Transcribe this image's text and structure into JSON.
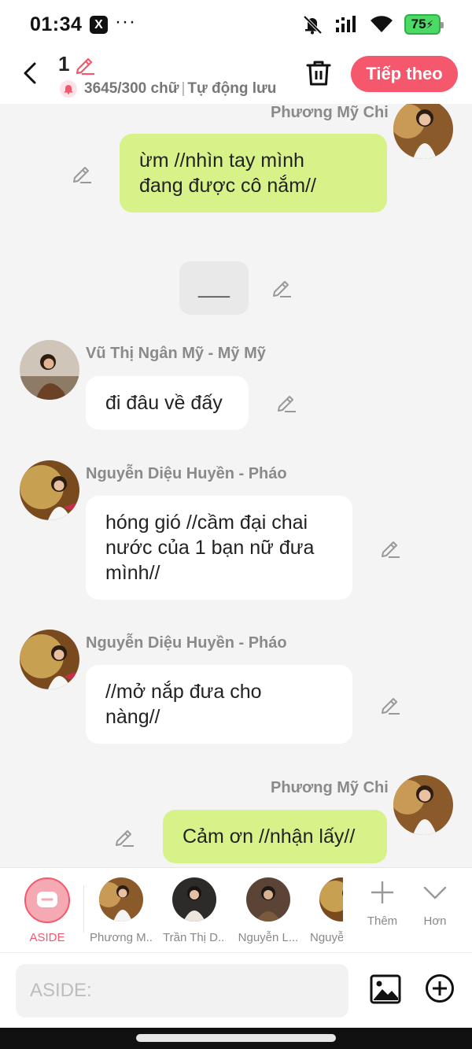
{
  "status_bar": {
    "time": "01:34",
    "app_badge": "X",
    "overflow": "···",
    "battery": "75"
  },
  "header": {
    "doc_number": "1",
    "word_count": "3645/300 chữ",
    "autosave": "Tự động lưu",
    "next_button": "Tiếp theo"
  },
  "messages": [
    {
      "side": "right",
      "speaker": "Phương Mỹ Chi",
      "text": "ừm //nhìn tay mình\nđang được cô nắm//"
    },
    {
      "side": "narration",
      "text": "___"
    },
    {
      "side": "left",
      "speaker": "Vũ Thị Ngân Mỹ - Mỹ Mỹ",
      "text": "đi đâu về đấy"
    },
    {
      "side": "left",
      "speaker": "Nguyễn Diệu Huyền - Pháo",
      "text": "hóng gió //cầm đại chai\nnước của 1 bạn nữ đưa\nmình//"
    },
    {
      "side": "left",
      "speaker": "Nguyễn Diệu Huyền - Pháo",
      "text": "//mở nắp đưa cho\nnàng//"
    },
    {
      "side": "right",
      "speaker": "Phương Mỹ Chi",
      "text": "Cảm ơn //nhận lấy//"
    }
  ],
  "character_bar": {
    "aside_label": "ASIDE",
    "characters": [
      "Phương M...",
      "Trần Thị D...",
      "Nguyễn L...",
      "Nguyễ"
    ],
    "add_label": "Thêm",
    "more_label": "Hơn"
  },
  "composer": {
    "placeholder": "ASIDE:"
  },
  "colors": {
    "accent": "#f5576c",
    "bubble_right": "#d8f28a",
    "bubble_left": "#ffffff",
    "background": "#f4f4f4"
  }
}
